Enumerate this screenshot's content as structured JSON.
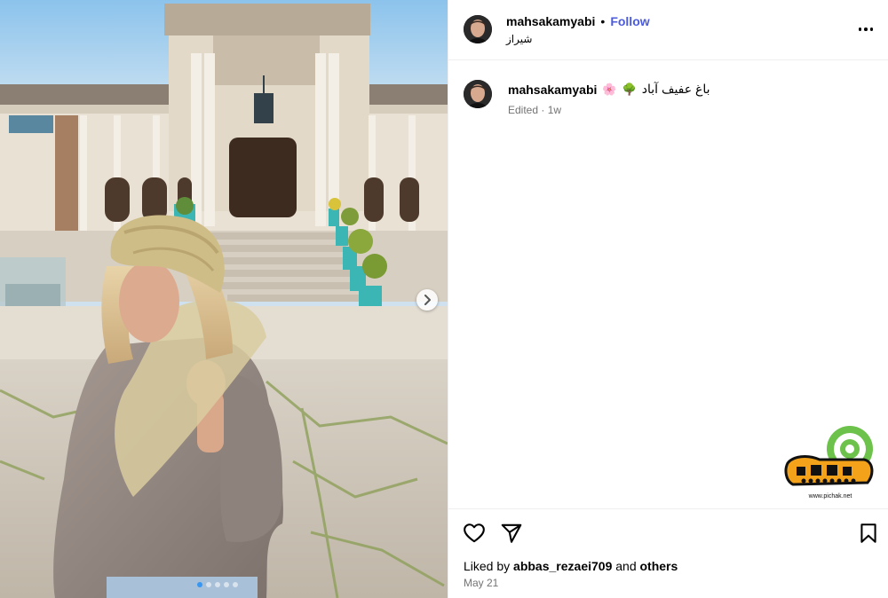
{
  "post": {
    "username": "mahsakamyabi",
    "separator": "•",
    "follow_label": "Follow",
    "location": "شیراز",
    "more_icon": "more-options-icon"
  },
  "caption": {
    "username": "mahsakamyabi",
    "emoji_flower": "🌸",
    "emoji_tree": "🌳",
    "text": "باغ عفیف آباد",
    "meta": "Edited · 1w"
  },
  "likes": {
    "prefix": "Liked by",
    "user": "abbas_rezaei709",
    "and": "and",
    "others": "others"
  },
  "date": "May 21",
  "carousel": {
    "dot_count": 5,
    "active_index": 0
  },
  "watermark": {
    "site": "www.pichak.net"
  },
  "colors": {
    "follow": "#4b5bdc",
    "muted": "#737373",
    "active_dot": "#3897f0"
  }
}
